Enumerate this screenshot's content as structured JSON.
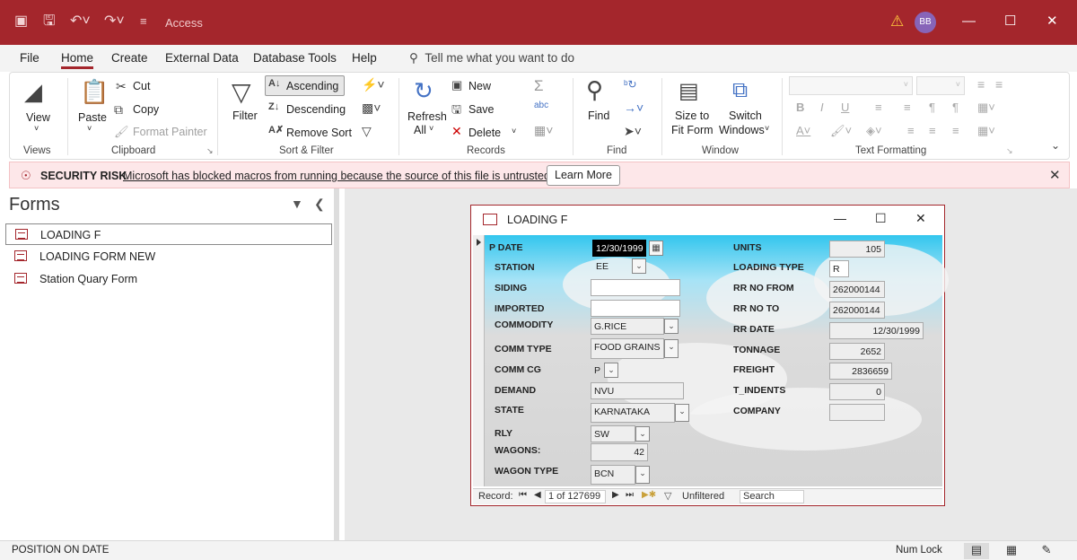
{
  "app": {
    "title": "Access",
    "user_initials": "BB"
  },
  "menu": [
    "File",
    "Home",
    "Create",
    "External Data",
    "Database Tools",
    "Help"
  ],
  "tell_me": "Tell me what you want to do",
  "ribbon": {
    "views": {
      "view": "View",
      "label": "Views"
    },
    "clipboard": {
      "paste": "Paste",
      "cut": "Cut",
      "copy": "Copy",
      "format_painter": "Format Painter",
      "label": "Clipboard"
    },
    "sort_filter": {
      "filter": "Filter",
      "ascending": "Ascending",
      "descending": "Descending",
      "remove_sort": "Remove Sort",
      "label": "Sort & Filter"
    },
    "records": {
      "refresh": "Refresh",
      "refresh_all": "All",
      "new": "New",
      "save": "Save",
      "delete": "Delete",
      "label": "Records"
    },
    "find": {
      "find": "Find",
      "label": "Find"
    },
    "window": {
      "size_to_fit": "Size to",
      "size_to_fit2": "Fit Form",
      "switch": "Switch",
      "switch2": "Windows",
      "label": "Window"
    },
    "text_formatting": {
      "label": "Text Formatting"
    }
  },
  "security": {
    "title": "SECURITY RISK",
    "message": "Microsoft has blocked macros from running because the source of this file is untrusted.",
    "button": "Learn More"
  },
  "nav": {
    "title": "Forms",
    "items": [
      "LOADING F",
      "LOADING FORM NEW",
      "Station Quary Form"
    ]
  },
  "form": {
    "title": "LOADING F",
    "left_fields": {
      "p_date": {
        "label": "P DATE",
        "value": "12/30/1999"
      },
      "station": {
        "label": "STATION",
        "value": "EE"
      },
      "siding": {
        "label": "SIDING",
        "value": ""
      },
      "imported": {
        "label": "IMPORTED",
        "value": ""
      },
      "commodity": {
        "label": "COMMODITY",
        "value": "G.RICE"
      },
      "comm_type": {
        "label": "COMM TYPE",
        "value": "FOOD GRAINS"
      },
      "comm_cg": {
        "label": "COMM CG",
        "value": "P"
      },
      "demand": {
        "label": "DEMAND",
        "value": "NVU"
      },
      "state": {
        "label": "STATE",
        "value": "KARNATAKA"
      },
      "rly": {
        "label": "RLY",
        "value": "SW"
      },
      "wagons": {
        "label": "WAGONS:",
        "value": "42"
      },
      "wagon_type": {
        "label": "WAGON TYPE",
        "value": "BCN"
      }
    },
    "right_fields": {
      "units": {
        "label": "UNITS",
        "value": "105"
      },
      "loading_type": {
        "label": "LOADING TYPE",
        "value": "R"
      },
      "rr_no_from": {
        "label": "RR NO FROM",
        "value": "262000144"
      },
      "rr_no_to": {
        "label": "RR NO TO",
        "value": "262000144"
      },
      "rr_date": {
        "label": "RR DATE",
        "value": "12/30/1999"
      },
      "tonnage": {
        "label": "TONNAGE",
        "value": "2652"
      },
      "freight": {
        "label": "FREIGHT",
        "value": "2836659"
      },
      "t_indents": {
        "label": "T_INDENTS",
        "value": "0"
      },
      "company": {
        "label": "COMPANY",
        "value": ""
      }
    },
    "record_nav": {
      "label": "Record:",
      "position": "1 of 127699",
      "filter": "Unfiltered",
      "search": "Search"
    }
  },
  "status": {
    "left": "POSITION ON DATE",
    "num_lock": "Num Lock"
  }
}
